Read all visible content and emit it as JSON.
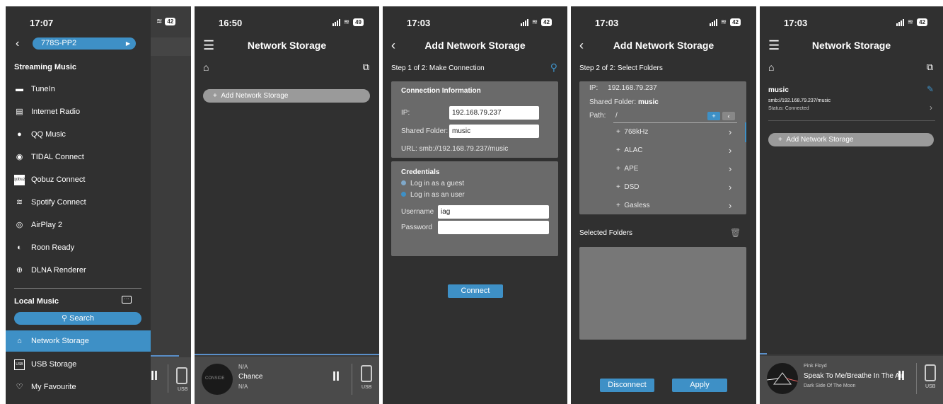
{
  "panel1": {
    "time": "17:07",
    "battery": "42",
    "device": "778S-PP2",
    "streaming_header": "Streaming Music",
    "streaming_items": [
      "TuneIn",
      "Internet Radio",
      "QQ Music",
      "TIDAL Connect",
      "Qobuz Connect",
      "Spotify Connect",
      "AirPlay 2",
      "Roon Ready",
      "DLNA Renderer"
    ],
    "local_header": "Local Music",
    "search_label": "Search",
    "local_items": [
      "Network Storage",
      "USB Storage",
      "My Favourite"
    ],
    "usb_label": "USB"
  },
  "panel2": {
    "time": "16:50",
    "battery": "49",
    "title": "Network Storage",
    "add_label": "Add Network Storage",
    "player": {
      "line1": "N/A",
      "title": "Chance",
      "line3": "N/A",
      "art_text": "CONSIDE"
    },
    "usb_label": "USB"
  },
  "panel3": {
    "time": "17:03",
    "battery": "42",
    "title": "Add Network Storage",
    "step": "Step 1 of 2: Make Connection",
    "conn_header": "Connection Information",
    "ip_label": "IP:",
    "ip_value": "192.168.79.237",
    "folder_label": "Shared Folder:",
    "folder_value": "music",
    "url_label": "URL:",
    "url_value": "smb://192.168.79.237/music",
    "cred_header": "Credentials",
    "guest_label": "Log in as a guest",
    "user_label": "Log in as an user",
    "username_label": "Username",
    "username_value": "iag",
    "password_label": "Password",
    "password_value": "",
    "connect_label": "Connect"
  },
  "panel4": {
    "time": "17:03",
    "battery": "42",
    "title": "Add Network Storage",
    "step": "Step 2 of 2: Select Folders",
    "ip_label": "IP:",
    "ip_value": "192.168.79.237",
    "folder_label": "Shared Folder:",
    "folder_value": "music",
    "path_label": "Path:",
    "path_value": "/",
    "folders": [
      "768kHz",
      "ALAC",
      "APE",
      "DSD",
      "Gasless"
    ],
    "selected_label": "Selected Folders",
    "disconnect_label": "Disconnect",
    "apply_label": "Apply"
  },
  "panel5": {
    "time": "17:03",
    "battery": "42",
    "title": "Network Storage",
    "share_name": "music",
    "share_url": "smb://192.168.79.237/music",
    "share_status": "Status: Connected",
    "add_label": "Add Network Storage",
    "player": {
      "artist": "Pink Floyd",
      "title": "Speak To Me/Breathe In The Air",
      "album": "Dark Side Of The Moon"
    },
    "usb_label": "USB"
  },
  "colors": {
    "accent": "#3e90c6",
    "background": "#303030",
    "panel": "#6a6a6a"
  }
}
